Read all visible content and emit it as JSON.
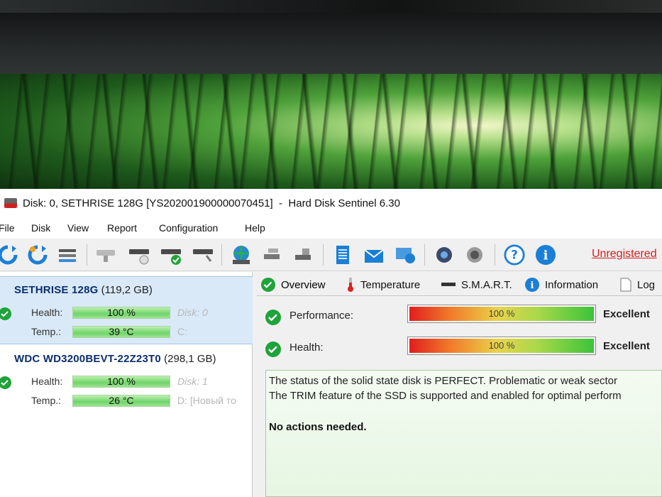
{
  "window": {
    "title": "Disk: 0, SETHRISE 128G [YS202001900000070451]  -  Hard Disk Sentinel 6.30"
  },
  "menu": [
    "File",
    "Disk",
    "View",
    "Report",
    "Configuration",
    "Help"
  ],
  "toolbar": {
    "unregistered_label": "Unregistered"
  },
  "disks": [
    {
      "name": "SETHRISE 128G",
      "size": "(119,2 GB)",
      "health_label": "Health:",
      "health_value": "100 %",
      "temp_label": "Temp.:",
      "temp_value": "39 °C",
      "disk_index": "Disk: 0",
      "volume": "C:"
    },
    {
      "name": "WDC WD3200BEVT-22Z23T0",
      "size": "(298,1 GB)",
      "health_label": "Health:",
      "health_value": "100 %",
      "temp_label": "Temp.:",
      "temp_value": "26 °C",
      "disk_index": "Disk: 1",
      "volume": "D: [Новый то"
    }
  ],
  "tabs": [
    "Overview",
    "Temperature",
    "S.M.A.R.T.",
    "Information",
    "Log"
  ],
  "overview": {
    "performance": {
      "label": "Performance:",
      "value": "100 %",
      "grade": "Excellent",
      "level": 100
    },
    "health": {
      "label": "Health:",
      "value": "100 %",
      "grade": "Excellent",
      "level": 100
    },
    "status_lines": [
      "The status of the solid state disk is PERFECT. Problematic or weak sector",
      "The TRIM feature of the SSD is supported and enabled for optimal perform"
    ],
    "actions": "No actions needed."
  },
  "colors": {
    "accent_ok": "#1fa33a",
    "unregistered": "#d61b1b",
    "selected_row": "#d9e9f8"
  }
}
